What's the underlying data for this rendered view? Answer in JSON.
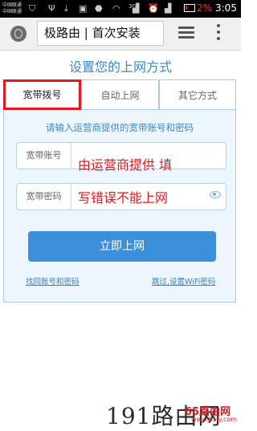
{
  "status_bar": {
    "carrier1": "中国联通",
    "carrier2": "中国联通",
    "net_type": "3G",
    "battery_percent": "2%",
    "time": "3:05"
  },
  "browser": {
    "url_text": "极路由 | 首次安装"
  },
  "page": {
    "title": "设置您的上网方式",
    "tabs": [
      {
        "label": "宽带拨号",
        "active": true
      },
      {
        "label": "自动上网",
        "active": false
      },
      {
        "label": "其它方式",
        "active": false
      }
    ],
    "hint": "请输入运营商提供的宽带账号和密码",
    "account_label": "宽带账号",
    "password_label": "宽带密码",
    "annotation_line1": "由运营商提供 填",
    "annotation_line2": "写错误不能上网",
    "submit_label": "立即上网",
    "link_recover": "找回账号和密码",
    "link_skip": "跳过,设置WiFi密码"
  },
  "watermark": {
    "text": "191路由网",
    "logo_text": "65路由网",
    "url": "www.65ly.com"
  },
  "colors": {
    "accent": "#3a89c7",
    "button": "#3b8fdb",
    "highlight": "#e01a22"
  }
}
